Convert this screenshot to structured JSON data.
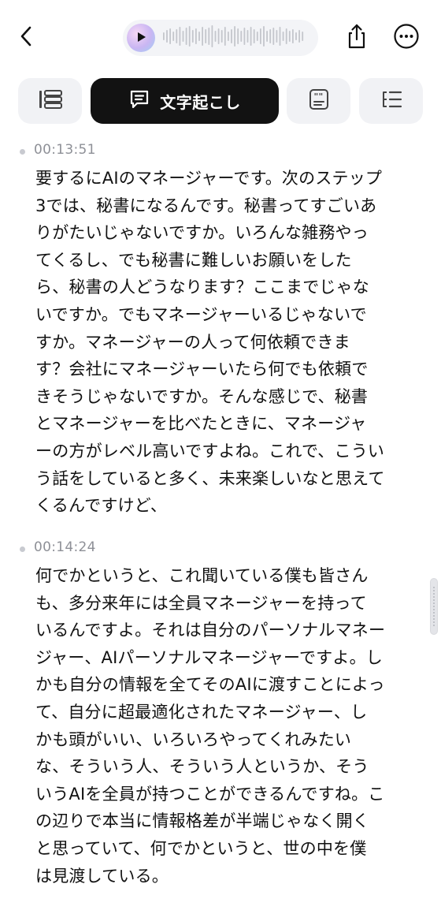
{
  "header": {
    "back_icon": "chevron-left-icon",
    "player": {
      "play_icon": "play-icon",
      "waveform_icon": "waveform-icon"
    },
    "share_icon": "share-icon",
    "more_icon": "more-icon"
  },
  "tabs": [
    {
      "icon": "list-icon",
      "label": "",
      "selected": false
    },
    {
      "icon": "chat-bubble-icon",
      "label": "文字起こし",
      "selected": true
    },
    {
      "icon": "summary-quote-icon",
      "label": "",
      "selected": false
    },
    {
      "icon": "outline-icon",
      "label": "",
      "selected": false
    }
  ],
  "transcript": {
    "segments": [
      {
        "timestamp": "00:13:51",
        "text": "要するにAIのマネージャーです。次のステップ\n3では、秘書になるんです。秘書ってすごいあ\nりがたいじゃないですか。いろんな雑務やっ\nてくるし、でも秘書に難しいお願いをした\nら、秘書の人どうなります？ここまでじゃな\nいですか。でもマネージャーいるじゃないで\nすか。マネージャーの人って何依頼できま\nす？会社にマネージャーいたら何でも依頼で\nきそうじゃないですか。そんな感じで、秘書\nとマネージャーを比べたときに、マネージャ\nーの方がレベル高いですよね。これで、こうい\nう話をしていると多く、未来楽しいなと思えて\nくるんですけど、"
      },
      {
        "timestamp": "00:14:24",
        "text": "何でかというと、これ聞いている僕も皆さん\nも、多分来年には全員マネージャーを持って\nいるんですよ。それは自分のパーソナルマネー\nジャー、AIパーソナルマネージャーですよ。し\nかも自分の情報を全てそのAIに渡すことによっ\nて、自分に超最適化されたマネージャー、し\nかも頭がいい、いろいろやってくれみたい\nな、そういう人、そういう人というか、そう\nいうAIを全員が持つことができるんですね。こ\nの辺りで本当に情報格差が半端じゃなく開く\nと思っていて、何でかというと、世の中を僕\nは見渡している。"
      }
    ]
  },
  "colors": {
    "selected_tab_bg": "#121212",
    "tab_bg": "#f1f2f5",
    "timestamp_text": "#8e9097",
    "body_text": "#111111"
  }
}
